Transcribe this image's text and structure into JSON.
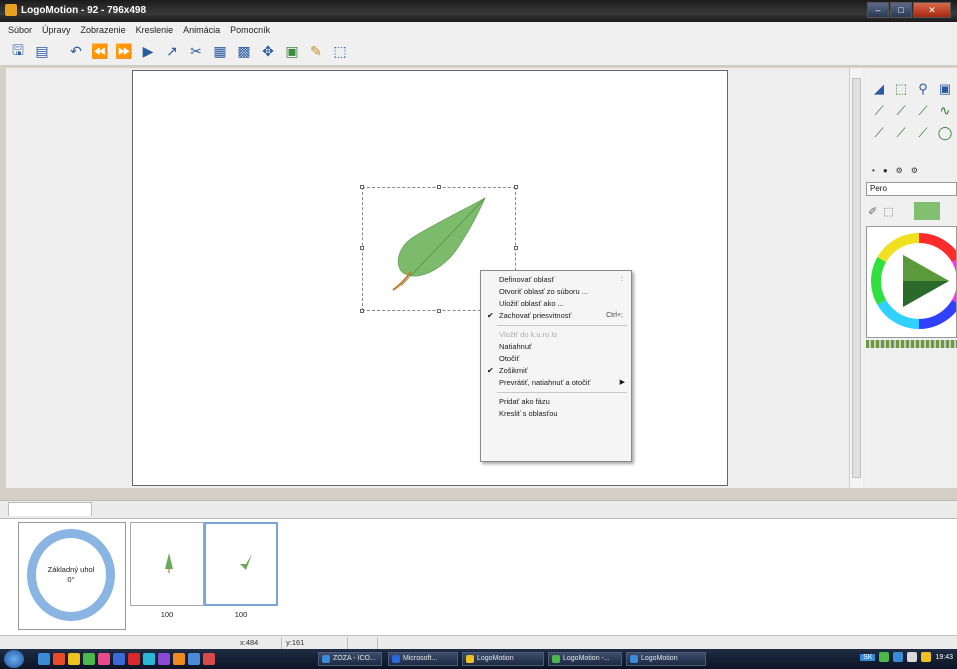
{
  "window": {
    "title": "LogoMotion - 92 - 796x498",
    "controls": {
      "minimize": "–",
      "maximize": "□",
      "close": "✕"
    }
  },
  "menubar": {
    "items": [
      "Súbor",
      "Úpravy",
      "Zobrazenie",
      "Kreslenie",
      "Animácia",
      "Pomocník"
    ]
  },
  "toolbar": {
    "icons": [
      "open-icon",
      "save-icon",
      "undo-icon",
      "rewind-icon",
      "fast-forward-icon",
      "play-icon",
      "path-icon",
      "cut-icon",
      "copy-frame-icon",
      "paste-frame-icon",
      "move-icon",
      "image-icon",
      "pencil-icon",
      "select-icon"
    ]
  },
  "canvas": {
    "leaf_color": "#7dbb6c",
    "stem_color": "#c8782a"
  },
  "context_menu": {
    "items": [
      {
        "label": "Definovať oblasť",
        "shortcut": "",
        "checked": false,
        "disabled": false,
        "submenu": false
      },
      {
        "label": "Otvoriť oblasť zo súboru ...",
        "shortcut": "",
        "checked": false,
        "disabled": false,
        "submenu": false
      },
      {
        "label": "Uložiť oblasť ako ...",
        "shortcut": "",
        "checked": false,
        "disabled": false,
        "submenu": false
      },
      {
        "label": "Zachovať priesvitnosť",
        "shortcut": "Ctrl+;",
        "checked": true,
        "disabled": false,
        "submenu": false
      },
      {
        "label": "Vložiť do k.u.ro.lo",
        "shortcut": "",
        "checked": false,
        "disabled": true,
        "submenu": false
      },
      {
        "label": "Natiahnuť",
        "shortcut": "",
        "checked": false,
        "disabled": false,
        "submenu": false
      },
      {
        "label": "Otočiť",
        "shortcut": "",
        "checked": false,
        "disabled": false,
        "submenu": false
      },
      {
        "label": "Zošikmiť",
        "shortcut": "",
        "checked": true,
        "disabled": false,
        "submenu": false
      },
      {
        "label": "Prevrátiť, natiahnuť a otočiť",
        "shortcut": "",
        "checked": false,
        "disabled": false,
        "submenu": true
      },
      {
        "label": "Pridať ako fázu",
        "shortcut": "",
        "checked": false,
        "disabled": false,
        "submenu": false
      },
      {
        "label": "Kresliť s oblasťou",
        "shortcut": "",
        "checked": false,
        "disabled": false,
        "submenu": false
      }
    ],
    "separators_after": [
      3,
      8
    ]
  },
  "right_panel": {
    "pen_select_value": "Pero",
    "current_color": "#80c070"
  },
  "timeline": {
    "base_frame_label": "Základný uhol",
    "base_frame_value": "0°",
    "frames": [
      {
        "label": "100",
        "selected": false
      },
      {
        "label": "100",
        "selected": true
      }
    ]
  },
  "statusbar": {
    "x": "x:484",
    "y": "y:161"
  },
  "taskbar": {
    "buttons": [
      "ZOZA - ICO...",
      "Microsoft...",
      "LogoMotion",
      "LogoMotion -...",
      "LogoMotion"
    ],
    "tray_lang": "SK",
    "clock": "19:43"
  }
}
